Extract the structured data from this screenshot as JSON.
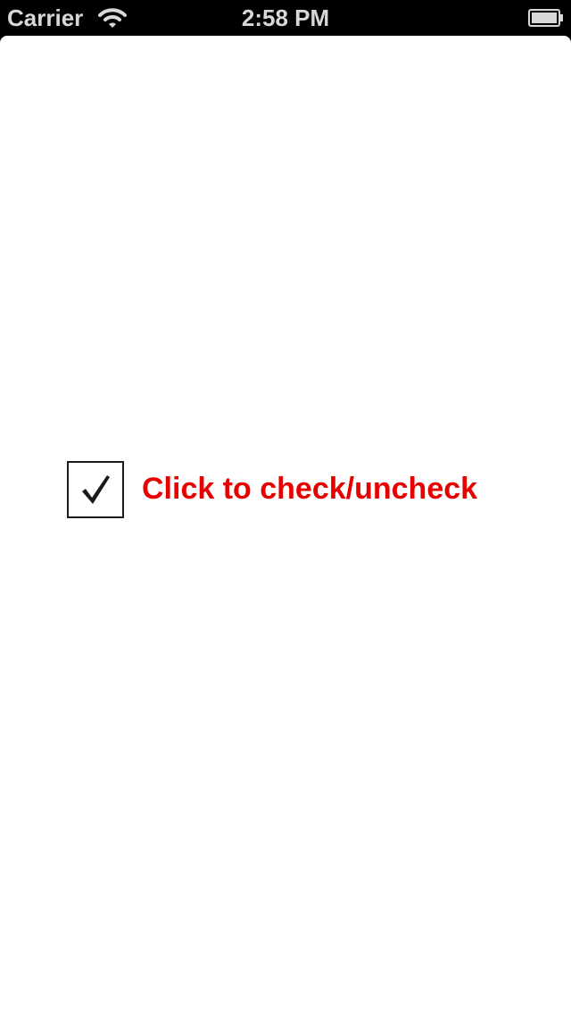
{
  "status_bar": {
    "carrier": "Carrier",
    "time": "2:58 PM",
    "icons": [
      "wifi-icon",
      "battery-icon"
    ]
  },
  "checkbox": {
    "label": "Click to check/uncheck",
    "checked": true,
    "label_color": "#e60000",
    "icon": "checkmark-icon"
  }
}
